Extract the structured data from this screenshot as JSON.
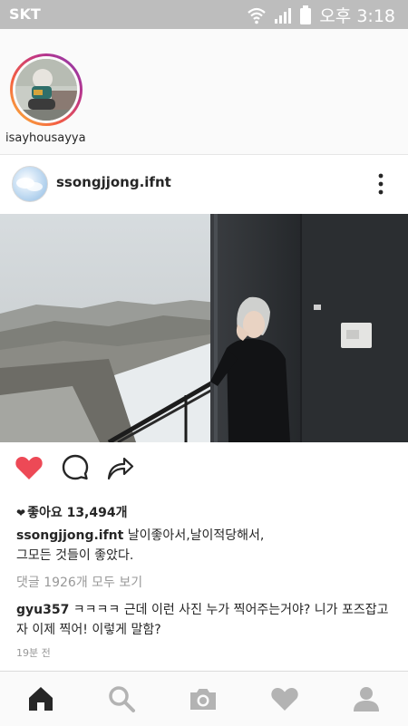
{
  "status_bar": {
    "carrier": "SKT",
    "time": "오후 3:18"
  },
  "stories": {
    "items": [
      {
        "username": "isayhousayya"
      }
    ]
  },
  "post": {
    "username": "ssongjjong.ifnt",
    "likes_label": "좋아요 13,494개",
    "caption_user": "ssongjjong.ifnt",
    "caption_text": "날이좋아서,날이적당해서,\n그모든 것들이 좋았다.",
    "view_comments": "댓글 1926개 모두 보기",
    "comment": {
      "user": "gyu357",
      "text": "ㅋㅋㅋㅋ 근데 이런 사진 누가 찍어주는거야? 니가 포즈잡고 자 이제 찍어! 이렇게 말함?"
    },
    "time_ago": "19분 전",
    "liked": true
  },
  "icons": {
    "status": [
      "wifi-icon",
      "signal-icon",
      "battery-icon"
    ],
    "post_actions": [
      "heart-icon",
      "comment-icon",
      "share-icon"
    ],
    "bottom_nav": [
      "home-icon",
      "search-icon",
      "camera-icon",
      "activity-heart-icon",
      "profile-icon"
    ]
  },
  "colors": {
    "like_red": "#ed4956",
    "status_bar_bg": "#bdbdbd",
    "text": "#262626",
    "muted": "#999999"
  }
}
